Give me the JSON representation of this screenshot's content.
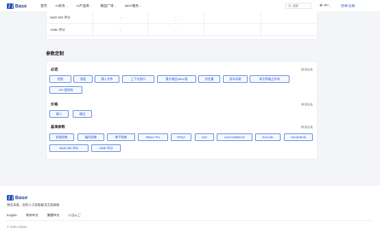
{
  "header": {
    "brand": "Base",
    "nav": [
      {
        "label": "首页",
        "dropdown": false
      },
      {
        "label": "AI资讯",
        "dropdown": true
      },
      {
        "label": "AI产品库",
        "dropdown": true
      },
      {
        "label": "模型广场",
        "dropdown": true
      },
      {
        "label": "MCP服务",
        "dropdown": true
      }
    ],
    "search_placeholder": "搜索",
    "language": "ZH",
    "login": "登录/注册"
  },
  "table": {
    "rows": [
      {
        "name": "Math 500 评分",
        "v1": "-",
        "v2": "-"
      },
      {
        "name": "AIME 评分",
        "v1": "-",
        "v2": "-"
      }
    ]
  },
  "params": {
    "title": "参数定制",
    "select_all": "取消全选",
    "groups": {
      "basic": {
        "title": "必选",
        "chips": [
          "性能",
          "速度",
          "输入文件",
          "上下文窗口",
          "最大输出token值",
          "吞吐量",
          "发布日期",
          "知识库截止时间",
          "API 提供商"
        ]
      },
      "price": {
        "title": "价格",
        "chips": [
          "输入",
          "输出"
        ]
      },
      "bench": {
        "title": "基准参数",
        "chips": [
          "智能指数",
          "编码指数",
          "数学指数",
          "MMLU Pro",
          "GPQA",
          "HLE",
          "LiveCodeBench",
          "SciCode",
          "HumanEval",
          "Math 500 评分",
          "AIME 评分"
        ]
      }
    }
  },
  "footer": {
    "brand": "Base",
    "slogan": "预见未来，您的人工智能解决方案联络",
    "languages": [
      "English",
      "简体中文",
      "繁體中文",
      "にほんご"
    ],
    "copyright": "© 2025 AIbase"
  },
  "colors": {
    "accent": "#2a5bd7",
    "brand": "#1f4fb8",
    "chip_border": "#5f86d9",
    "chip_bg": "#f5f8ff"
  }
}
